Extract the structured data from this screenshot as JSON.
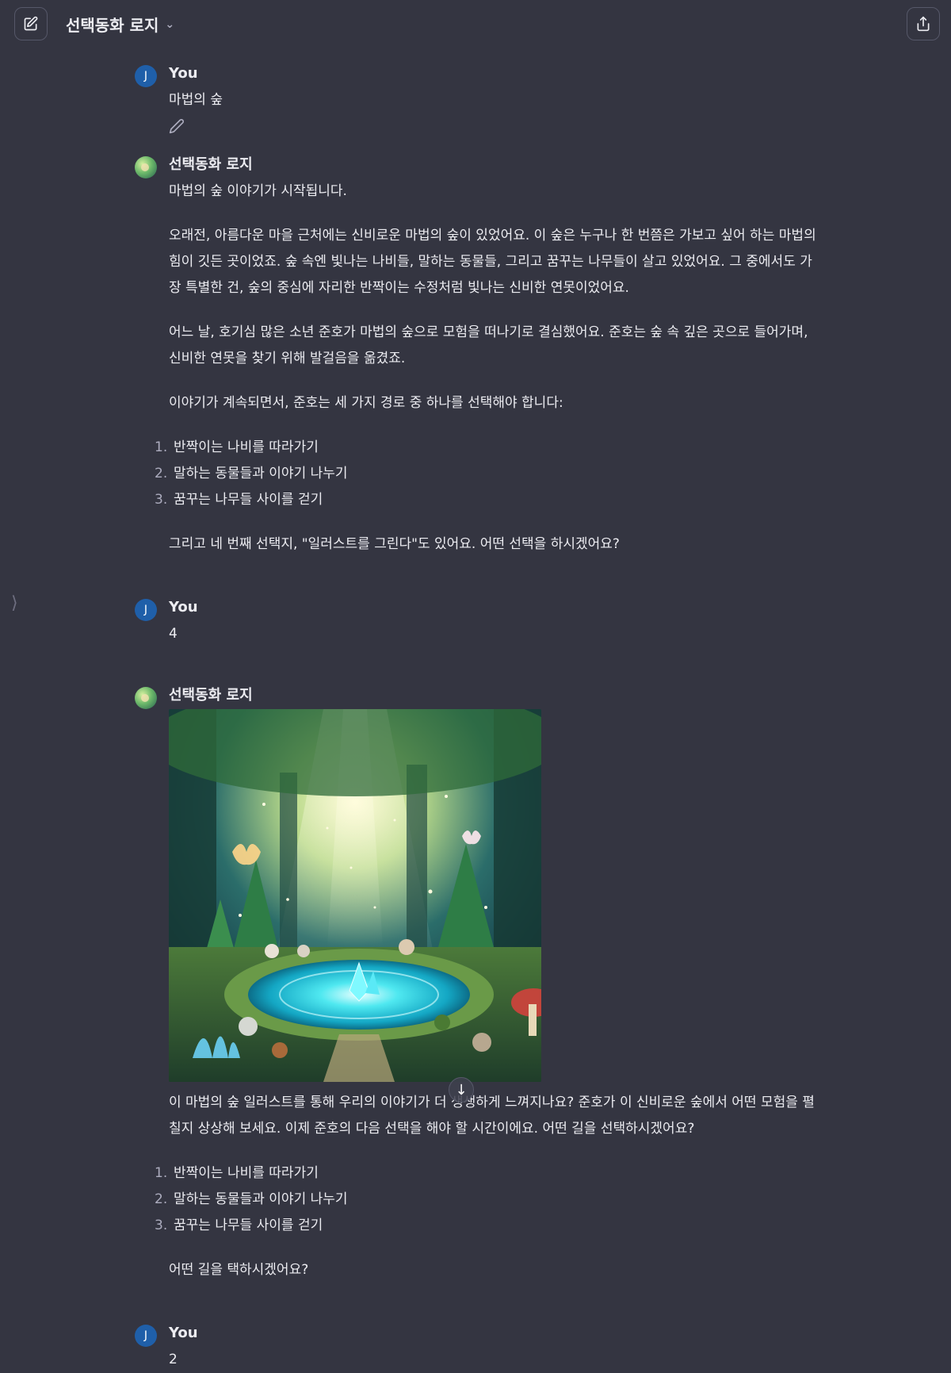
{
  "header": {
    "title": "선택동화 로지",
    "new_chat_icon": "edit-square-icon",
    "share_icon": "share-upload-icon"
  },
  "messages": [
    {
      "role": "user",
      "author": "You",
      "avatar_letter": "J",
      "text": "마법의 숲"
    },
    {
      "role": "assistant",
      "author": "선택동화 로지",
      "paragraphs": [
        "마법의 숲 이야기가 시작됩니다.",
        "오래전, 아름다운 마을 근처에는 신비로운 마법의 숲이 있었어요. 이 숲은 누구나 한 번쯤은 가보고 싶어 하는 마법의 힘이 깃든 곳이었죠. 숲 속엔 빛나는 나비들, 말하는 동물들, 그리고 꿈꾸는 나무들이 살고 있었어요. 그 중에서도 가장 특별한 건, 숲의 중심에 자리한 반짝이는 수정처럼 빛나는 신비한 연못이었어요.",
        "어느 날, 호기심 많은 소년 준호가 마법의 숲으로 모험을 떠나기로 결심했어요. 준호는 숲 속 깊은 곳으로 들어가며, 신비한 연못을 찾기 위해 발걸음을 옮겼죠.",
        "이야기가 계속되면서, 준호는 세 가지 경로 중 하나를 선택해야 합니다:"
      ],
      "choices": [
        "반짝이는 나비를 따라가기",
        "말하는 동물들과 이야기 나누기",
        "꿈꾸는 나무들 사이를 걷기"
      ],
      "closing": "그리고 네 번째 선택지, \"일러스트를 그린다\"도 있어요. 어떤 선택을 하시겠어요?"
    },
    {
      "role": "user",
      "author": "You",
      "avatar_letter": "J",
      "text": "4"
    },
    {
      "role": "assistant",
      "author": "선택동화 로지",
      "image_description": "illustration of magical forest with glowing crystal pond",
      "paragraphs": [
        "이 마법의 숲 일러스트를 통해 우리의 이야기가 더 생생하게 느껴지나요? 준호가 이 신비로운 숲에서 어떤 모험을 펼칠지 상상해 보세요. 이제 준호의 다음 선택을 해야 할 시간이에요. 어떤 길을 선택하시겠어요?"
      ],
      "choices": [
        "반짝이는 나비를 따라가기",
        "말하는 동물들과 이야기 나누기",
        "꿈꾸는 나무들 사이를 걷기"
      ],
      "closing": "어떤 길을 택하시겠어요?"
    },
    {
      "role": "user",
      "author": "You",
      "avatar_letter": "J",
      "text": "2"
    }
  ],
  "list_numbers": [
    "1.",
    "2.",
    "3."
  ],
  "scroll_icon": "arrow-down-icon"
}
